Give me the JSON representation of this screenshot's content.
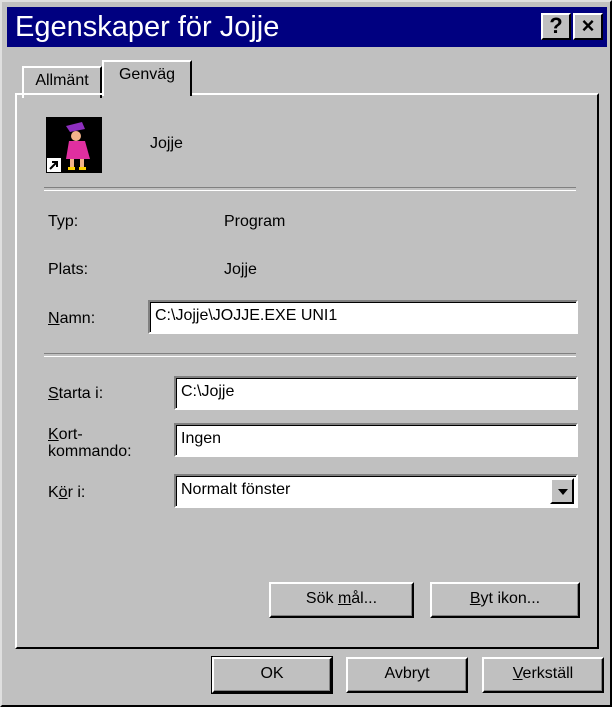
{
  "window": {
    "title": "Egenskaper för Jojje",
    "help_label": "?",
    "close_label": "×"
  },
  "tabs": [
    {
      "label": "Allmänt"
    },
    {
      "label": "Genväg"
    }
  ],
  "shortcut": {
    "name": "Jojje",
    "icon": "jojje-program-icon"
  },
  "info": {
    "type_label": "Typ:",
    "type_value": "Program",
    "location_label": "Plats:",
    "location_value": "Jojje"
  },
  "fields": {
    "target_label": "Namn:",
    "target_value": "C:\\Jojje\\JOJJE.EXE  UNI1",
    "startin_label": "Starta i:",
    "startin_value": "C:\\Jojje",
    "hotkey_label": "Kort-\nkommando:",
    "hotkey_value": "Ingen",
    "run_label": "Kör i:",
    "run_value": "Normalt fönster"
  },
  "buttons": {
    "find_target": "Sök mål...",
    "change_icon": "Byt ikon...",
    "ok": "OK",
    "cancel": "Avbryt",
    "apply": "Verkställ"
  }
}
